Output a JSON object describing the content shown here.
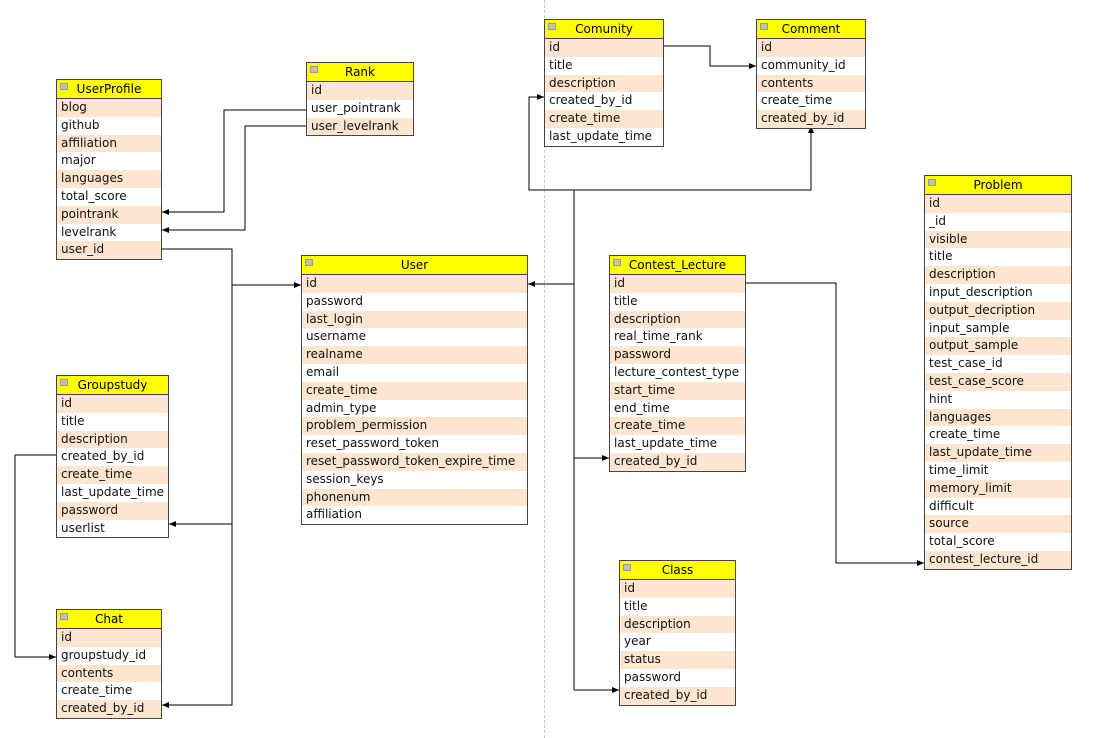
{
  "colors": {
    "header": "#ffff00",
    "row_alt": "#fde5cf",
    "line": "#000000"
  },
  "entities": [
    {
      "name": "UserProfile",
      "fields": [
        "blog",
        "github",
        "affiliation",
        "major",
        "languages",
        "total_score",
        "pointrank",
        "levelrank",
        "user_id"
      ]
    },
    {
      "name": "Rank",
      "fields": [
        "id",
        "user_pointrank",
        "user_levelrank"
      ]
    },
    {
      "name": "Comunity",
      "fields": [
        "id",
        "title",
        "description",
        "created_by_id",
        "create_time",
        "last_update_time"
      ]
    },
    {
      "name": "Comment",
      "fields": [
        "id",
        "community_id",
        "contents",
        "create_time",
        "created_by_id"
      ]
    },
    {
      "name": "User",
      "fields": [
        "id",
        "password",
        "last_login",
        "username",
        "realname",
        "email",
        "create_time",
        "admin_type",
        "problem_permission",
        "reset_password_token",
        "reset_password_token_expire_time",
        "session_keys",
        "phonenum",
        "affiliation"
      ]
    },
    {
      "name": "Contest_Lecture",
      "fields": [
        "id",
        "title",
        "description",
        "real_time_rank",
        "password",
        "lecture_contest_type",
        "start_time",
        "end_time",
        "create_time",
        "last_update_time",
        "created_by_id"
      ]
    },
    {
      "name": "Problem",
      "fields": [
        "id",
        "_id",
        "visible",
        "title",
        "description",
        "input_description",
        "output_decription",
        "input_sample",
        "output_sample",
        "test_case_id",
        "test_case_score",
        "hint",
        "languages",
        "create_time",
        "last_update_time",
        "time_limit",
        "memory_limit",
        "difficult",
        "source",
        "total_score",
        "contest_lecture_id"
      ]
    },
    {
      "name": "Groupstudy",
      "fields": [
        "id",
        "title",
        "description",
        "created_by_id",
        "create_time",
        "last_update_time",
        "password",
        "userlist"
      ]
    },
    {
      "name": "Chat",
      "fields": [
        "id",
        "groupstudy_id",
        "contents",
        "create_time",
        "created_by_id"
      ]
    },
    {
      "name": "Class",
      "fields": [
        "id",
        "title",
        "description",
        "year",
        "status",
        "password",
        "created_by_id"
      ]
    }
  ]
}
